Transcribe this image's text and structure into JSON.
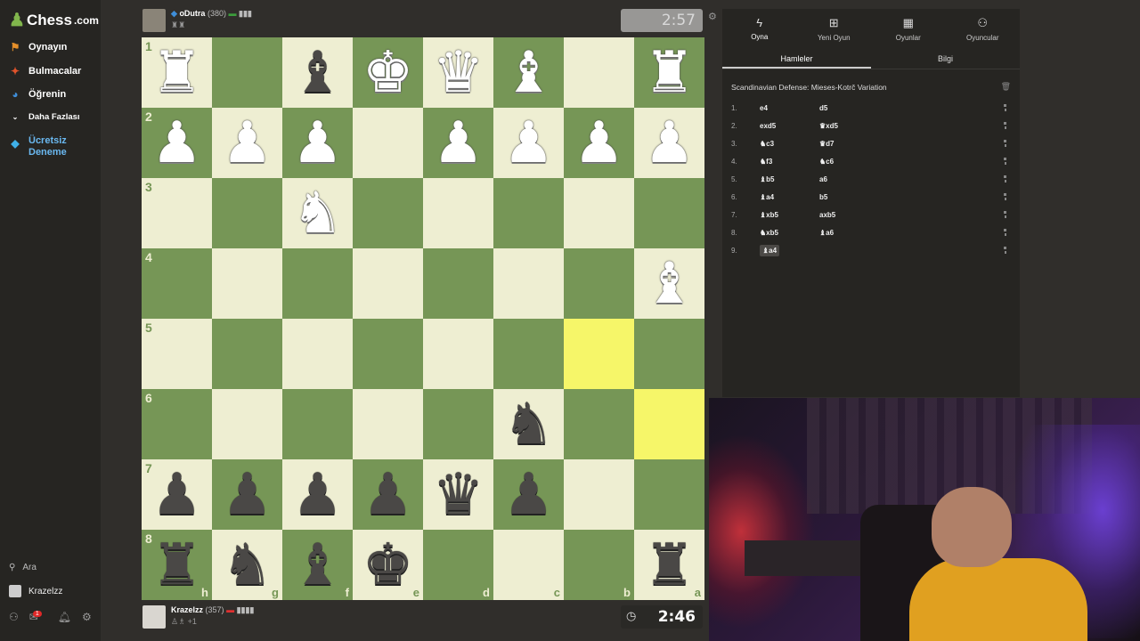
{
  "sidebar": {
    "logo": "Chess",
    "logo_suffix": ".com",
    "items": [
      {
        "label": "Oynayın",
        "icon": "play-icon"
      },
      {
        "label": "Bulmacalar",
        "icon": "puzzle-icon"
      },
      {
        "label": "Öğrenin",
        "icon": "learn-icon"
      },
      {
        "label": "Daha Fazlası",
        "icon": "chevron-down-icon"
      },
      {
        "label": "Ücretsiz Deneme",
        "icon": "diamond-icon"
      }
    ],
    "search_label": "Ara",
    "user": "Krazelzz",
    "notification_count": "1"
  },
  "top_player": {
    "name": "oDutra",
    "rating": "(380)",
    "clock": "2:57"
  },
  "bottom_player": {
    "name": "Krazelzz",
    "rating": "(357)",
    "sub": "+1",
    "clock": "2:46"
  },
  "board": {
    "orientation": "black",
    "rank_labels": [
      "1",
      "2",
      "3",
      "4",
      "5",
      "6",
      "7",
      "8"
    ],
    "file_labels": [
      "h",
      "g",
      "f",
      "e",
      "d",
      "c",
      "b",
      "a"
    ],
    "highlight": [
      "b5",
      "a6"
    ],
    "position": [
      [
        "wR",
        "",
        "bB",
        "wK",
        "wQ",
        "wB",
        "",
        "wR"
      ],
      [
        "wP",
        "wP",
        "wP",
        "",
        "wP",
        "wP",
        "wP",
        "wP"
      ],
      [
        "",
        "",
        "wN",
        "",
        "",
        "",
        "",
        ""
      ],
      [
        "",
        "",
        "",
        "",
        "",
        "",
        "",
        "wB"
      ],
      [
        "",
        "",
        "",
        "",
        "",
        "",
        "",
        ""
      ],
      [
        "",
        "",
        "",
        "",
        "",
        "bN",
        "",
        ""
      ],
      [
        "bP",
        "bP",
        "bP",
        "bP",
        "bQ",
        "bP",
        "",
        ""
      ],
      [
        "bR",
        "bN",
        "bB",
        "bK",
        "",
        "",
        "",
        "bR"
      ]
    ]
  },
  "panel": {
    "tabs": [
      {
        "label": "Oyna",
        "icon": "lightning-icon"
      },
      {
        "label": "Yeni Oyun",
        "icon": "plus-icon"
      },
      {
        "label": "Oyunlar",
        "icon": "board-icon"
      },
      {
        "label": "Oyuncular",
        "icon": "players-icon"
      }
    ],
    "subtabs": [
      "Hamleler",
      "Bilgi"
    ],
    "opening": "Scandinavian Defense: Mieses-Kotrč Variation",
    "moves": [
      {
        "n": "1.",
        "w": "e4",
        "b": "d5"
      },
      {
        "n": "2.",
        "w": "exd5",
        "b": "♛xd5"
      },
      {
        "n": "3.",
        "w": "♞c3",
        "b": "♛d7"
      },
      {
        "n": "4.",
        "w": "♞f3",
        "b": "♞c6"
      },
      {
        "n": "5.",
        "w": "♝b5",
        "b": "a6"
      },
      {
        "n": "6.",
        "w": "♝a4",
        "b": "b5"
      },
      {
        "n": "7.",
        "w": "♝xb5",
        "b": "axb5"
      },
      {
        "n": "8.",
        "w": "♞xb5",
        "b": "♝a6"
      },
      {
        "n": "9.",
        "w": "♝a4",
        "b": ""
      }
    ]
  }
}
